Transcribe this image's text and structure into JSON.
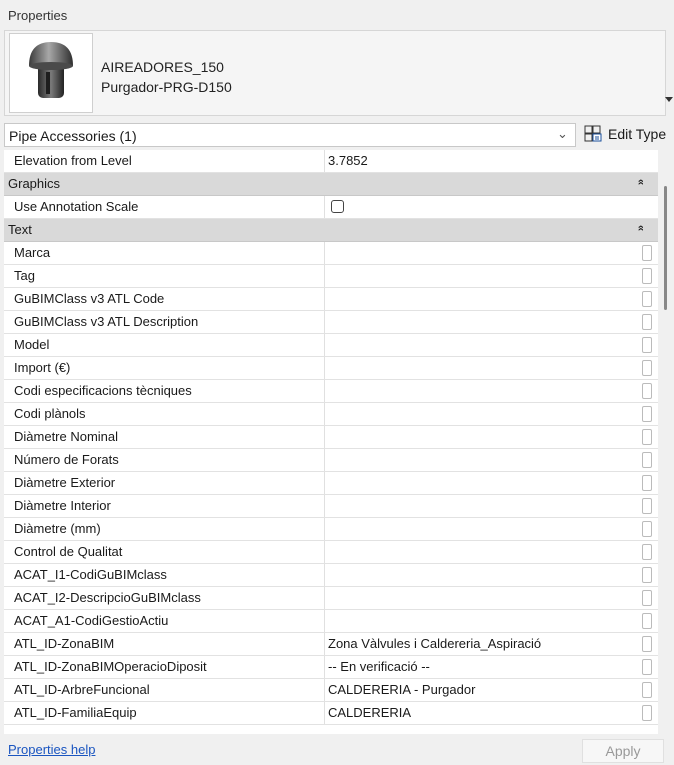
{
  "panel": {
    "title": "Properties"
  },
  "type_selector": {
    "family": "AIREADORES_150",
    "type": "Purgador-PRG-D150"
  },
  "filter": {
    "label": "Pipe Accessories (1)",
    "edit_type": "Edit Type"
  },
  "rows": [
    {
      "kind": "prop",
      "name": "Elevation from Level",
      "value": "3.7852"
    },
    {
      "kind": "group",
      "name": "Graphics"
    },
    {
      "kind": "check",
      "name": "Use Annotation Scale",
      "checked": false
    },
    {
      "kind": "group",
      "name": "Text"
    },
    {
      "kind": "prop",
      "name": "Marca",
      "value": ""
    },
    {
      "kind": "prop",
      "name": "Tag",
      "value": ""
    },
    {
      "kind": "prop",
      "name": "GuBIMClass v3 ATL Code",
      "value": ""
    },
    {
      "kind": "prop",
      "name": "GuBIMClass v3 ATL Description",
      "value": ""
    },
    {
      "kind": "prop",
      "name": "Model",
      "value": ""
    },
    {
      "kind": "prop",
      "name": "Import (€)",
      "value": ""
    },
    {
      "kind": "prop",
      "name": "Codi especificacions tècniques",
      "value": ""
    },
    {
      "kind": "prop",
      "name": "Codi plànols",
      "value": ""
    },
    {
      "kind": "prop",
      "name": "Diàmetre Nominal",
      "value": ""
    },
    {
      "kind": "prop",
      "name": "Número de Forats",
      "value": ""
    },
    {
      "kind": "prop",
      "name": "Diàmetre Exterior",
      "value": ""
    },
    {
      "kind": "prop",
      "name": "Diàmetre Interior",
      "value": ""
    },
    {
      "kind": "prop",
      "name": "Diàmetre (mm)",
      "value": ""
    },
    {
      "kind": "prop",
      "name": "Control de Qualitat",
      "value": ""
    },
    {
      "kind": "prop",
      "name": "ACAT_I1-CodiGuBIMclass",
      "value": ""
    },
    {
      "kind": "prop",
      "name": "ACAT_I2-DescripcioGuBIMclass",
      "value": ""
    },
    {
      "kind": "prop",
      "name": "ACAT_A1-CodiGestioActiu",
      "value": ""
    },
    {
      "kind": "prop",
      "name": "ATL_ID-ZonaBIM",
      "value": "Zona Vàlvules i Caldereria_Aspiració"
    },
    {
      "kind": "prop",
      "name": "ATL_ID-ZonaBIMOperacioDiposit",
      "value": "-- En verificació --"
    },
    {
      "kind": "prop",
      "name": "ATL_ID-ArbreFuncional",
      "value": "CALDERERIA - Purgador"
    },
    {
      "kind": "prop",
      "name": "ATL_ID-FamiliaEquip",
      "value": "CALDERERIA"
    }
  ],
  "footer": {
    "help": "Properties help",
    "apply": "Apply"
  }
}
